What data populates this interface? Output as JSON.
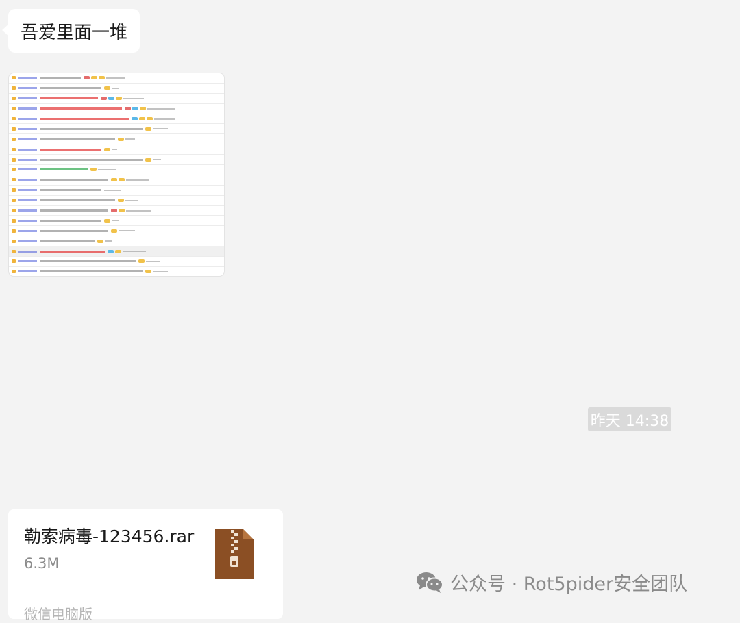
{
  "messages": {
    "text_message": "吾爱里面一堆",
    "timestamp": "昨天 14:38",
    "file": {
      "name": "勒索病毒-123456.rar",
      "size": "6.3M",
      "source": "微信电脑版"
    }
  },
  "thumbnail": {
    "rows": [
      {
        "variant": "normal",
        "title_w": 60,
        "badges": [
          "#e46c6c",
          "#f1c24a",
          "#f1c24a"
        ],
        "pages_w": 28
      },
      {
        "variant": "normal",
        "title_w": 90,
        "badges": [
          "#f1c24a"
        ],
        "pages_w": 10
      },
      {
        "variant": "red",
        "title_w": 85,
        "badges": [
          "#e46c6c",
          "#5bb8e8",
          "#f1c24a"
        ],
        "pages_w": 30
      },
      {
        "variant": "red",
        "title_w": 120,
        "badges": [
          "#e46c6c",
          "#5bb8e8",
          "#f1c24a"
        ],
        "pages_w": 40
      },
      {
        "variant": "red",
        "title_w": 130,
        "badges": [
          "#5bb8e8",
          "#f1c24a",
          "#f1c24a"
        ],
        "pages_w": 30
      },
      {
        "variant": "normal",
        "title_w": 150,
        "badges": [
          "#f1c24a"
        ],
        "pages_w": 22
      },
      {
        "variant": "normal",
        "title_w": 110,
        "badges": [
          "#f1c24a"
        ],
        "pages_w": 14
      },
      {
        "variant": "red",
        "title_w": 90,
        "badges": [
          "#f1c24a"
        ],
        "pages_w": 8
      },
      {
        "variant": "normal",
        "title_w": 150,
        "badges": [
          "#f1c24a"
        ],
        "pages_w": 12
      },
      {
        "variant": "green",
        "title_w": 70,
        "badges": [
          "#f1c24a"
        ],
        "pages_w": 26
      },
      {
        "variant": "normal",
        "title_w": 100,
        "badges": [
          "#f1c24a",
          "#f1c24a"
        ],
        "pages_w": 34
      },
      {
        "variant": "normal",
        "title_w": 90,
        "badges": [],
        "pages_w": 24
      },
      {
        "variant": "normal",
        "title_w": 110,
        "badges": [
          "#f1c24a"
        ],
        "pages_w": 18
      },
      {
        "variant": "normal",
        "title_w": 100,
        "badges": [
          "#e46c6c",
          "#f1c24a"
        ],
        "pages_w": 36
      },
      {
        "variant": "normal",
        "title_w": 90,
        "badges": [
          "#f1c24a"
        ],
        "pages_w": 10
      },
      {
        "variant": "normal",
        "title_w": 100,
        "badges": [
          "#f1c24a"
        ],
        "pages_w": 24
      },
      {
        "variant": "normal",
        "title_w": 80,
        "badges": [
          "#f1c24a"
        ],
        "pages_w": 10
      },
      {
        "variant": "red",
        "title_w": 95,
        "badges": [
          "#5bb8e8",
          "#f1c24a"
        ],
        "pages_w": 34,
        "highlight": true
      },
      {
        "variant": "normal",
        "title_w": 140,
        "badges": [
          "#f1c24a"
        ],
        "pages_w": 20
      },
      {
        "variant": "normal",
        "title_w": 150,
        "badges": [
          "#f1c24a"
        ],
        "pages_w": 22
      }
    ]
  },
  "watermark": {
    "icon": "wechat-icon",
    "text": "公众号 · Rot5pider安全团队"
  },
  "colors": {
    "background": "#f3f3f3",
    "bubble": "#ffffff",
    "timestamp_bg": "#dadada",
    "file_icon": "#8b4f24"
  }
}
